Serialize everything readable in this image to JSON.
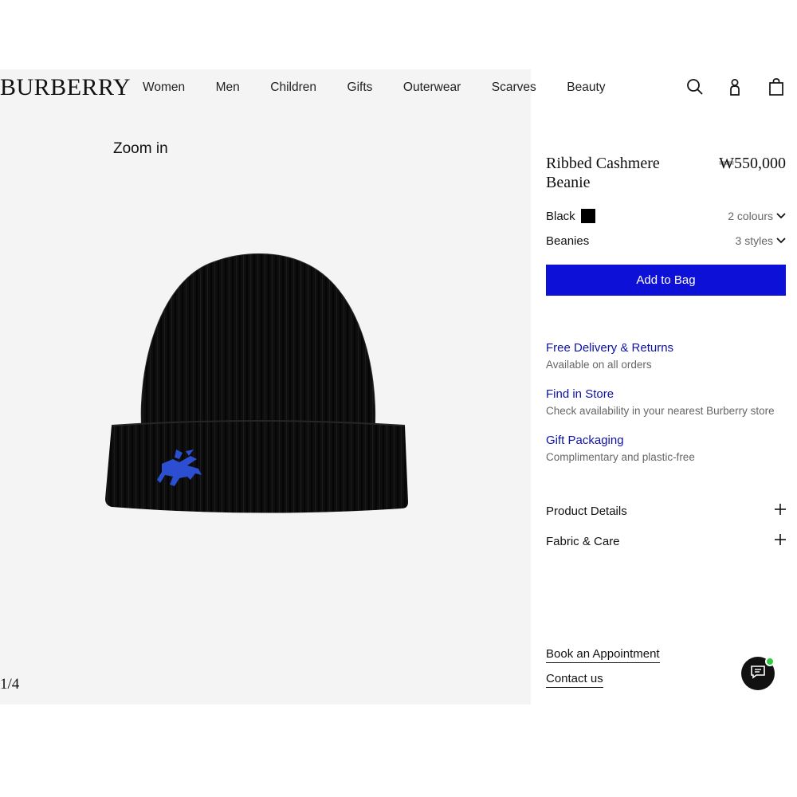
{
  "header": {
    "logo": "BURBERRY",
    "nav": [
      "Women",
      "Men",
      "Children",
      "Gifts",
      "Outerwear",
      "Scarves",
      "Beauty"
    ],
    "icons": [
      "search-icon",
      "account-icon",
      "bag-icon"
    ]
  },
  "gallery": {
    "zoom_label": "Zoom in",
    "counter": "1/4"
  },
  "product": {
    "title": "Ribbed Cashmere Beanie",
    "price": "₩550,000",
    "colour_label": "Black",
    "colour_swatch": "#000000",
    "colours_link": "2 colours",
    "category_label": "Beanies",
    "styles_link": "3 styles",
    "add_to_bag": "Add to Bag",
    "accent_color": "#0d11d8"
  },
  "services": [
    {
      "title": "Free Delivery & Returns",
      "desc": "Available on all orders"
    },
    {
      "title": "Find in Store",
      "desc": "Check availability in your nearest Burberry store"
    },
    {
      "title": "Gift Packaging",
      "desc": "Complimentary and plastic-free"
    }
  ],
  "accordions": [
    {
      "label": "Product Details"
    },
    {
      "label": "Fabric & Care"
    }
  ],
  "footer": {
    "book_appointment": "Book an Appointment",
    "contact_us": "Contact us"
  }
}
